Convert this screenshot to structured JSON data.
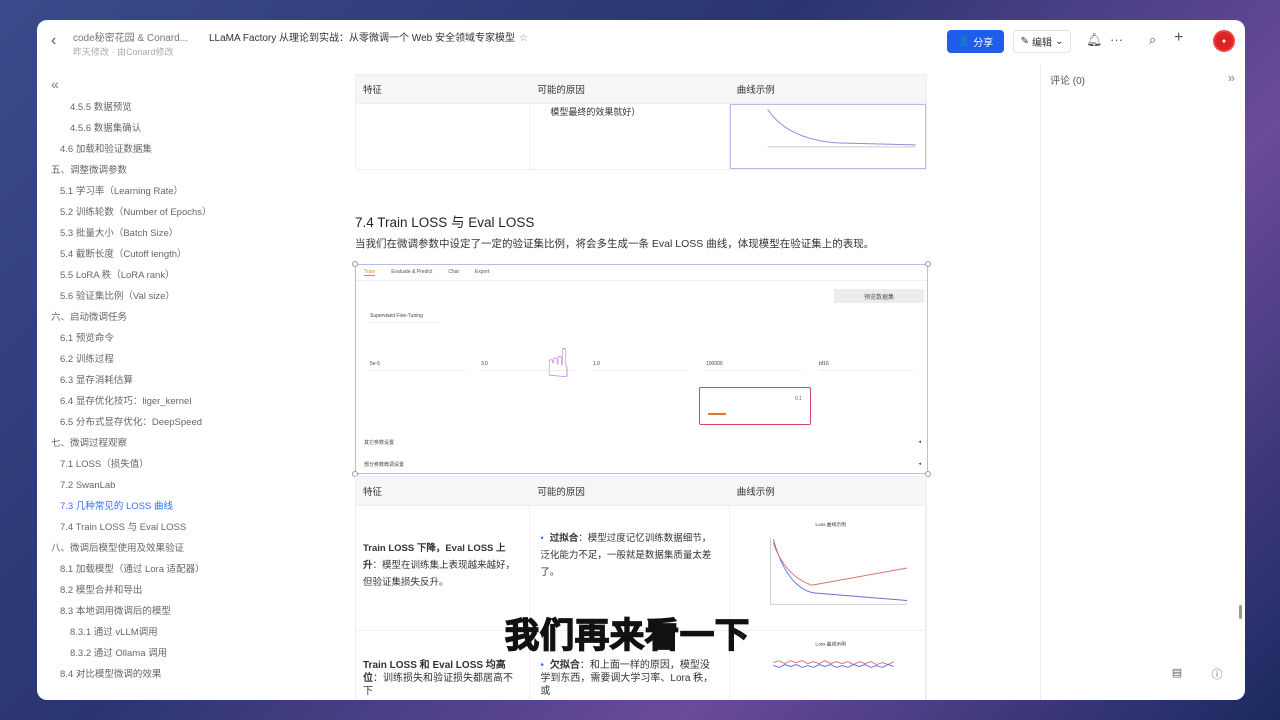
{
  "header": {
    "crumb": "code秘密花园 & Conard...",
    "title": "LLaMA Factory 从理论到实战：从零微调一个 Web 安全领域专家模型",
    "sub": "昨天修改 · 由Conard修改",
    "share": "分享",
    "edit": "编辑"
  },
  "sidebar": {
    "items": [
      {
        "label": "4.5.5 数据预览",
        "level": 3
      },
      {
        "label": "4.5.6 数据集确认",
        "level": 3
      },
      {
        "label": "4.6 加载和验证数据集",
        "level": 2
      },
      {
        "label": "五、调整微调参数",
        "level": 1
      },
      {
        "label": "5.1 学习率（Learning Rate）",
        "level": 2
      },
      {
        "label": "5.2 训练轮数（Number of Epochs）",
        "level": 2
      },
      {
        "label": "5.3 批量大小（Batch Size）",
        "level": 2
      },
      {
        "label": "5.4 截断长度（Cutoff length）",
        "level": 2
      },
      {
        "label": "5.5 LoRA 秩（LoRA rank）",
        "level": 2
      },
      {
        "label": "5.6 验证集比例（Val size）",
        "level": 2
      },
      {
        "label": "六、启动微调任务",
        "level": 1
      },
      {
        "label": "6.1 预览命令",
        "level": 2
      },
      {
        "label": "6.2 训练过程",
        "level": 2
      },
      {
        "label": "6.3 显存消耗估算",
        "level": 2
      },
      {
        "label": "6.4 显存优化技巧：liger_kernel",
        "level": 2
      },
      {
        "label": "6.5 分布式显存优化：DeepSpeed",
        "level": 2
      },
      {
        "label": "七、微调过程观察",
        "level": 1
      },
      {
        "label": "7.1 LOSS（损失值）",
        "level": 2
      },
      {
        "label": "7.2 SwanLab",
        "level": 2
      },
      {
        "label": "7.3 几种常见的 LOSS 曲线",
        "level": 2,
        "active": true
      },
      {
        "label": "7.4 Train LOSS 与 Eval LOSS",
        "level": 2
      },
      {
        "label": "八、微调后模型使用及效果验证",
        "level": 1
      },
      {
        "label": "8.1 加载模型（通过 Lora 适配器）",
        "level": 2
      },
      {
        "label": "8.2 模型合并和导出",
        "level": 2
      },
      {
        "label": "8.3 本地调用微调后的模型",
        "level": 2
      },
      {
        "label": "8.3.1 通过 vLLM调用",
        "level": 3
      },
      {
        "label": "8.3.2 通过 Ollama 调用",
        "level": 3
      },
      {
        "label": "8.4 对比模型微调的效果",
        "level": 2
      }
    ]
  },
  "table_top": {
    "headers": [
      "特征",
      "可能的原因",
      "曲线示例"
    ],
    "cell": "模型最终的效果就好）"
  },
  "section": {
    "heading": "7.4 Train LOSS 与 Eval LOSS",
    "paragraph": "当我们在微调参数中设定了一定的验证集比例，将会多生成一条 Eval LOSS 曲线，体现模型在验证集上的表现。"
  },
  "embedded": {
    "tabs": [
      "Train",
      "Evaluate & Predict",
      "Chat",
      "Export"
    ],
    "stage": "Supervised Fine-Tuning",
    "preview": "预览数据集",
    "lr": "5e-5",
    "epochs": "3.0",
    "grad": "1.0",
    "samples": "100000",
    "compute": "bf16",
    "val": "0.1",
    "acc1": "其它参数设置",
    "acc2": "部分参数微调设置"
  },
  "table": {
    "headers": [
      "特征",
      "可能的原因",
      "曲线示例"
    ],
    "rows": [
      {
        "feature_bold": "Train LOSS 下降，Eval LOSS 上升",
        "feature": "：模型在训练集上表现越来越好，但验证集损失反升。",
        "reason_bold": "过拟合",
        "reason": "：模型过度记忆训练数据细节，泛化能力不足，一般就是数据集质量太差了。",
        "chart_title": "Loss 曲线示例"
      },
      {
        "feature_bold": "Train LOSS 和 Eval LOSS 均高位",
        "feature": "：训练损失和验证损失都居高不下",
        "reason_bold": "欠拟合",
        "reason": "：和上面一样的原因，模型没学到东西，需要调大学习率、Lora 秩，或",
        "chart_title": "Loss 曲线示例"
      }
    ]
  },
  "comments": {
    "label": "评论 (0)"
  },
  "subtitle": "我们再来看一下",
  "colors": {
    "accent": "#3370ff",
    "share": "#1f5ce8",
    "train": "#6a6fd8",
    "eval": "#e07070"
  }
}
